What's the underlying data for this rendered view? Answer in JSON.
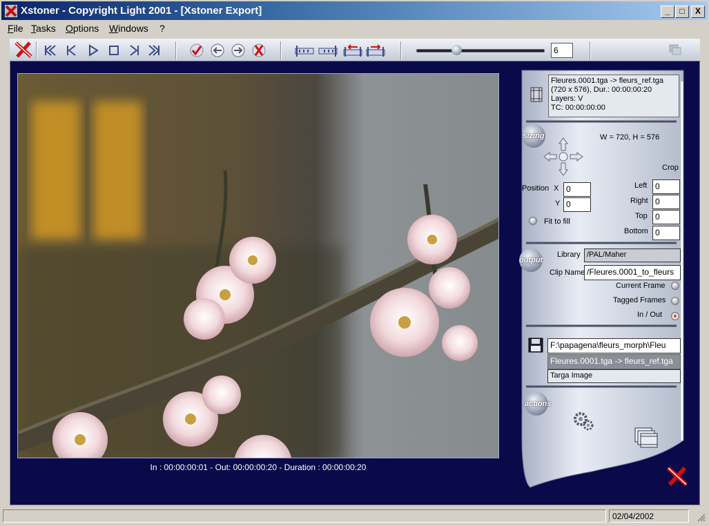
{
  "window": {
    "title": "Xstoner - Copyright Light 2001 - [Xstoner Export]",
    "minimize": "_",
    "maximize": "□",
    "close": "X"
  },
  "menu": [
    "File",
    "Tasks",
    "Options",
    "Windows",
    "?"
  ],
  "toolbar": {
    "frame_value": "6",
    "slider_position": 0.3,
    "icons": [
      "xstoner-logo-icon",
      "first-frame-icon",
      "previous-frame-icon",
      "play-icon",
      "stop-icon",
      "next-frame-icon",
      "last-frame-icon",
      "check-icon",
      "left-arrow-icon",
      "right-arrow-icon",
      "cancel-icon",
      "mark-in-icon",
      "mark-out-icon",
      "swap-left-icon",
      "swap-right-icon",
      "layers-icon"
    ]
  },
  "preview": {
    "caption": "In : 00:00:00:01 - Out: 00:00:00:20 - Duration : 00:00:00:20"
  },
  "info": {
    "lines": [
      "Fleures.0001.tga -> fleurs_ref.tga",
      "(720 x 576), Dur.: 00:00:00:20",
      "Layers: V",
      "TC: 00:00:00:00"
    ]
  },
  "sizing": {
    "section_label": "sizing",
    "dimensions": "W = 720, H = 576",
    "crop_label": "Crop",
    "position_label": "Position",
    "x_label": "X",
    "y_label": "Y",
    "x_value": "0",
    "y_value": "0",
    "fit_to_fill": "Fit to fill",
    "left_label": "Left",
    "right_label": "Right",
    "top_label": "Top",
    "bottom_label": "Bottom",
    "left_value": "0",
    "right_value": "0",
    "top_value": "0",
    "bottom_value": "0"
  },
  "output": {
    "section_label": "output",
    "library_label": "Library",
    "library_value": "/PAL/Maher",
    "clip_name_label": "Clip Name",
    "clip_name_value": "/Fleures.0001_to_fleurs",
    "current_frame": "Current Frame",
    "tagged_frames": "Tagged Frames",
    "in_out": "In / Out",
    "selected": "In / Out"
  },
  "file": {
    "path": "F:\\papagena\\fleurs_morph\\Fleu",
    "clip": "Fleures.0001.tga -> fleurs_ref.tga",
    "format": "Targa Image"
  },
  "actions": {
    "section_label": "actions"
  },
  "status": {
    "date": "02/04/2002"
  },
  "colors": {
    "frame_bg": "#0a0a4a",
    "title_start": "#0a246a",
    "title_end": "#a6caf0",
    "accent_red": "#e02010"
  }
}
